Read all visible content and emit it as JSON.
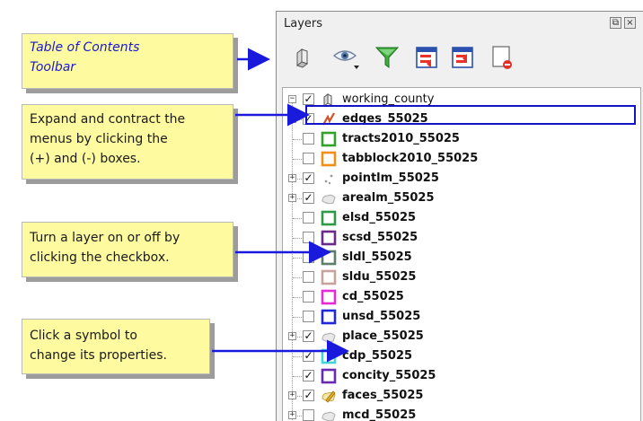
{
  "notes": [
    {
      "id": "toolbar",
      "text": "Table of Contents\nToolbar"
    },
    {
      "id": "expand",
      "text": "Expand and contract the\nmenus by clicking the\n(+) and (-) boxes."
    },
    {
      "id": "toggle",
      "text": "Turn a layer on or off by\nclicking the checkbox."
    },
    {
      "id": "symbol",
      "text": "Click a symbol to\nchange its properties."
    }
  ],
  "panel": {
    "title": "Layers",
    "title_buttons": [
      "restore-icon",
      "close-icon"
    ]
  },
  "toolbar": {
    "buttons": [
      {
        "name": "add-group-icon"
      },
      {
        "name": "visibility-eye-icon"
      },
      {
        "name": "filter-legend-icon"
      },
      {
        "name": "expand-all-icon"
      },
      {
        "name": "collapse-all-icon"
      },
      {
        "name": "remove-layer-icon"
      }
    ]
  },
  "colors": {
    "selection_outline": "#1212c8",
    "note_bg": "#fefaa0",
    "arrow": "#1a1adc"
  },
  "group": {
    "label": "working_county",
    "checked": true,
    "expanded": true
  },
  "layers": [
    {
      "label": "edges_55025",
      "checked": true,
      "expander": "+",
      "symbol": "line-icon",
      "color": "#d0502a",
      "selected": true
    },
    {
      "label": "tracts2010_55025",
      "checked": false,
      "expander": null,
      "symbol": "polygon-icon",
      "color": "#33a02c"
    },
    {
      "label": "tabblock2010_55025",
      "checked": false,
      "expander": null,
      "symbol": "polygon-icon",
      "color": "#f0901a"
    },
    {
      "label": "pointlm_55025",
      "checked": true,
      "expander": "+",
      "symbol": "points-icon",
      "color": "#9a9a9a"
    },
    {
      "label": "arealm_55025",
      "checked": true,
      "expander": "+",
      "symbol": "multi-polygon-icon",
      "color": "#b5b5b5"
    },
    {
      "label": "elsd_55025",
      "checked": false,
      "expander": null,
      "symbol": "polygon-icon",
      "color": "#2e9a46"
    },
    {
      "label": "scsd_55025",
      "checked": false,
      "expander": null,
      "symbol": "polygon-icon",
      "color": "#6a2a8a"
    },
    {
      "label": "sldl_55025",
      "checked": false,
      "expander": null,
      "symbol": "polygon-icon",
      "color": "#5c7f6a"
    },
    {
      "label": "sldu_55025",
      "checked": false,
      "expander": null,
      "symbol": "polygon-icon",
      "color": "#c7a39b"
    },
    {
      "label": "cd_55025",
      "checked": false,
      "expander": null,
      "symbol": "polygon-icon",
      "color": "#e62ad6"
    },
    {
      "label": "unsd_55025",
      "checked": false,
      "expander": null,
      "symbol": "polygon-icon",
      "color": "#1f2ad6"
    },
    {
      "label": "place_55025",
      "checked": true,
      "expander": "+",
      "symbol": "multi-polygon-icon",
      "color": "#b5b5b5"
    },
    {
      "label": "cdp_55025",
      "checked": true,
      "expander": null,
      "symbol": "polygon-icon",
      "color": "#40d6d6"
    },
    {
      "label": "concity_55025",
      "checked": true,
      "expander": null,
      "symbol": "polygon-icon",
      "color": "#6a2ab0"
    },
    {
      "label": "faces_55025",
      "checked": true,
      "expander": "+",
      "symbol": "pencil-polygon-icon",
      "color": "#e6b020"
    },
    {
      "label": "mcd_55025",
      "checked": false,
      "expander": "+",
      "symbol": "multi-polygon-icon",
      "color": "#b5b5b5"
    }
  ]
}
